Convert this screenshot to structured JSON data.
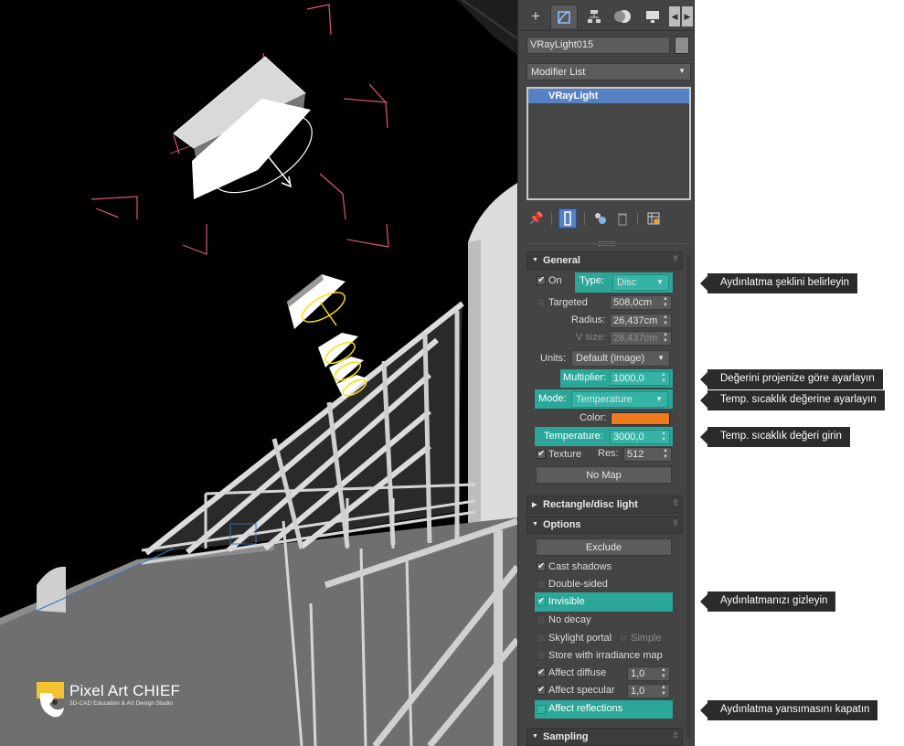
{
  "panel": {
    "object_name": "VRayLight015",
    "modifier_list": "Modifier List",
    "stack_item": "VRayLight",
    "tab_icons": [
      "create-icon",
      "modify-icon",
      "hierarchy-icon",
      "motion-icon",
      "display-icon"
    ],
    "stack_tool_icons": [
      "pin-stack-icon",
      "show-end-result-icon",
      "make-unique-icon",
      "remove-modifier-icon",
      "configure-modifier-sets-icon"
    ]
  },
  "general": {
    "title": "General",
    "on_label": "On",
    "type_label": "Type:",
    "type_value": "Disc",
    "targeted_label": "Targeted",
    "targeted_value": "508,0cm",
    "radius_label": "Radius:",
    "radius_value": "26,437cm",
    "vsize_label": "V size:",
    "vsize_value": "26,437cm",
    "units_label": "Units:",
    "units_value": "Default (image)",
    "multiplier_label": "Multiplier:",
    "multiplier_value": "1000,0",
    "mode_label": "Mode:",
    "mode_value": "Temperature",
    "color_label": "Color:",
    "color_hex": "#f07a1e",
    "temperature_label": "Temperature:",
    "temperature_value": "3000,0",
    "texture_label": "Texture",
    "res_label": "Res:",
    "res_value": "512",
    "nomap_label": "No Map"
  },
  "rect_rollout": {
    "title": "Rectangle/disc light"
  },
  "options": {
    "title": "Options",
    "exclude_label": "Exclude",
    "cast_shadows": "Cast shadows",
    "double_sided": "Double-sided",
    "invisible": "Invisible",
    "no_decay": "No decay",
    "skylight_portal": "Skylight portal",
    "simple": "Simple",
    "store_irradiance": "Store with irradiance map",
    "affect_diffuse": "Affect diffuse",
    "affect_diffuse_value": "1,0",
    "affect_specular": "Affect specular",
    "affect_specular_value": "1,0",
    "affect_reflections": "Affect reflections"
  },
  "sampling_rollout": {
    "title": "Sampling"
  },
  "callouts": [
    "Aydınlatma şeklini belirleyin",
    "Değerini projenize göre ayarlayın",
    "Temp. sıcaklık değerine ayarlayın",
    "Temp. sıcaklık değeri girin",
    "Aydınlatmanızı gizleyin",
    "Aydınlatma yansımasını kapatın"
  ],
  "logo": {
    "title": "Pixel Art CHIEF",
    "subtitle": "3D-CAD Education & Art Design Studio"
  },
  "colors": {
    "highlight": "#2ba79a",
    "selection": "#5681c4",
    "panel_bg": "#444444"
  }
}
